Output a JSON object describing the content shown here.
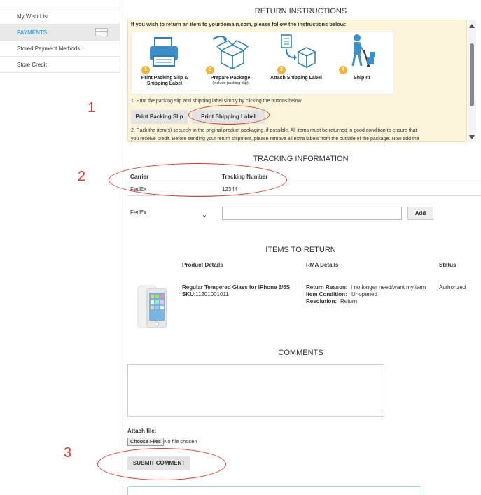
{
  "sidebar": {
    "items": [
      {
        "label": "My Wish List"
      },
      {
        "label": "PAYMENTS"
      },
      {
        "label": "Stored Payment Methods"
      },
      {
        "label": "Store Credit"
      }
    ]
  },
  "return_instructions": {
    "title": "RETURN INSTRUCTIONS",
    "intro": "If you wish to return an item to yourdomain.com, please follow the instructions below:",
    "steps": [
      {
        "num": "1",
        "label": "Print Packing Slip & Shipping Label",
        "sub": "",
        "icon": "printer-icon"
      },
      {
        "num": "2",
        "label": "Prepare Package",
        "sub": "(include packing slip)",
        "icon": "box-icon"
      },
      {
        "num": "3",
        "label": "Attach Shipping Label",
        "sub": "",
        "icon": "label-box-icon"
      },
      {
        "num": "4",
        "label": "Ship It!",
        "sub": "",
        "icon": "courier-icon"
      }
    ],
    "line1": "1. Print the packing slip and shipping label simply by clicking the buttons below.",
    "print_slip_label": "Print Packing Slip",
    "print_shipping_label": "Print Shipping Label",
    "line2a": "2. Pack the item(s) securely in the original product packaging, if possible. All items must be returned in good condition to ensure that",
    "line2b": "you receive credit. Before sending your return shipment, please remove all extra labels from the outside of the package. Now add the"
  },
  "tracking": {
    "title": "TRACKING INFORMATION",
    "col_carrier": "Carrier",
    "col_tracking": "Tracking Number",
    "rows": [
      {
        "carrier": "FedEx",
        "tracking": "12344"
      }
    ],
    "carrier_select_value": "FedEx",
    "tracking_input_value": "",
    "add_label": "Add"
  },
  "items": {
    "title": "ITEMS TO RETURN",
    "col_product": "Product Details",
    "col_rma": "RMA Details",
    "col_status": "Status",
    "rows": [
      {
        "product_name": "Regular Tempered Glass for iPhone 6/6S",
        "sku_label": "SKU:",
        "sku": "11201001011",
        "reason_label": "Return Reason:",
        "reason": "I no longer need/want my item",
        "condition_label": "Item Condition:",
        "condition": "Unopened",
        "resolution_label": "Resolution:",
        "resolution": "Return",
        "status": "Authorized"
      }
    ]
  },
  "comments": {
    "title": "COMMENTS",
    "textarea_value": "",
    "attach_label": "Attach file:",
    "choose_files_label": "Choose Files",
    "no_file_text": "No file chosen",
    "submit_label": "SUBMIT COMMENT"
  },
  "annotations": {
    "labels": [
      "1",
      "2",
      "3"
    ],
    "color": "#e03c31"
  },
  "colors": {
    "accent": "#3fa9d8",
    "panel_bg": "#fcf5dc",
    "step_badge": "#f4b23e"
  }
}
